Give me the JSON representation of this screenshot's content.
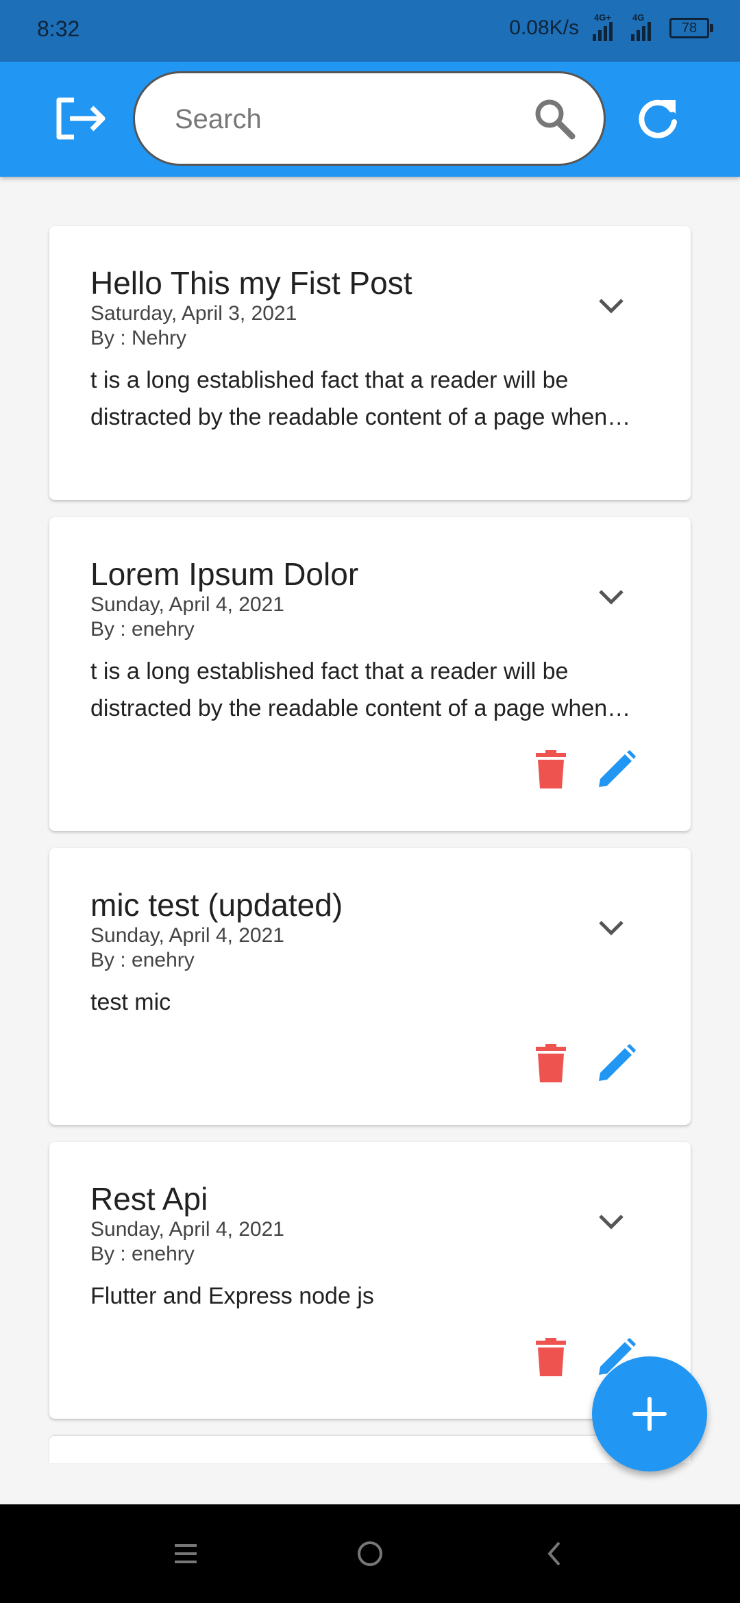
{
  "status_bar": {
    "time": "8:32",
    "net_speed": "0.08K/s",
    "signal_1": "4G+",
    "signal_2": "4G",
    "battery": "78"
  },
  "app_bar": {
    "search_placeholder": "Search",
    "logout_icon": "logout-icon",
    "search_icon": "search-icon",
    "refresh_icon": "refresh-icon",
    "color": "#2196f3"
  },
  "posts": [
    {
      "title": "Hello This my Fist Post",
      "date": "Saturday, April 3, 2021",
      "author": "By : Nehry",
      "body": "t is a long established fact that a reader will be distracted by the readable content of a page when looking at its layout.",
      "has_actions": false
    },
    {
      "title": "Lorem Ipsum Dolor",
      "date": "Sunday, April 4, 2021",
      "author": "By : enehry",
      "body": "t is a long established fact that a reader will be distracted by the readable content of a page when looking at its layout.",
      "has_actions": true
    },
    {
      "title": "mic test (updated)",
      "date": "Sunday, April 4, 2021",
      "author": "By : enehry",
      "body": "test mic",
      "has_actions": true
    },
    {
      "title": "Rest Api",
      "date": "Sunday, April 4, 2021",
      "author": "By : enehry",
      "body": "Flutter and Express node js",
      "has_actions": true
    }
  ],
  "icons": {
    "delete": "delete-icon",
    "edit": "edit-icon",
    "expand": "chevron-down-icon",
    "add": "plus-icon"
  },
  "colors": {
    "delete": "#ef5350",
    "edit": "#2196f3",
    "fab": "#2196f3"
  }
}
